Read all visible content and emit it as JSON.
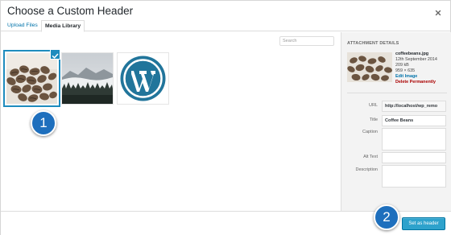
{
  "modal": {
    "title": "Choose a Custom Header"
  },
  "tabs": [
    {
      "label": "Upload Files",
      "active": false
    },
    {
      "label": "Media Library",
      "active": true
    }
  ],
  "search": {
    "placeholder": "Search"
  },
  "media": [
    {
      "name": "coffee-beans-photo",
      "selected": true
    },
    {
      "name": "misty-forest-photo",
      "selected": false
    },
    {
      "name": "wordpress-logo",
      "selected": false
    }
  ],
  "steps": [
    "1",
    "2"
  ],
  "attachment": {
    "heading": "ATTACHMENT DETAILS",
    "filename": "coffeebeans.jpg",
    "date": "12th September 2014",
    "size": "209 kB",
    "dimensions": "959 × 635",
    "edit_label": "Edit Image",
    "delete_label": "Delete Permanently"
  },
  "fields": {
    "url": {
      "label": "URL",
      "value": "http://localhost/wp_remo"
    },
    "title": {
      "label": "Title",
      "value": "Coffee Beans"
    },
    "caption": {
      "label": "Caption",
      "value": ""
    },
    "alt": {
      "label": "Alt Text",
      "value": ""
    },
    "description": {
      "label": "Description",
      "value": ""
    }
  },
  "footer": {
    "button_label": "Set as header"
  },
  "colors": {
    "accent": "#1e8cbe",
    "button": "#2ea2cc",
    "step_badge": "#1e6fbd",
    "delete": "#aa0000",
    "link": "#0073aa"
  },
  "icons": [
    "close-icon",
    "checkmark-icon"
  ]
}
